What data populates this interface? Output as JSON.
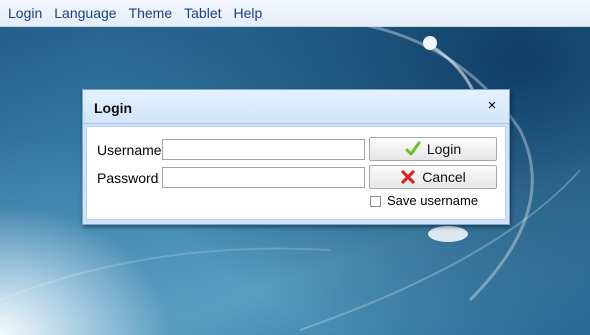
{
  "menubar": {
    "items": [
      {
        "label": "Login"
      },
      {
        "label": "Language"
      },
      {
        "label": "Theme"
      },
      {
        "label": "Tablet"
      },
      {
        "label": "Help"
      }
    ]
  },
  "dialog": {
    "title": "Login",
    "close_glyph": "×",
    "username_label": "Username",
    "password_label": "Password",
    "username_value": "",
    "password_value": "",
    "login_button_label": "Login",
    "cancel_button_label": "Cancel",
    "save_username_label": "Save username",
    "save_username_checked": false
  },
  "icons": {
    "login_icon": "checkmark-icon",
    "cancel_icon": "red-x-icon"
  },
  "colors": {
    "menu_text": "#1b3f8a",
    "dialog_frame": "#cfe3fa",
    "checkmark": "#6bbf2a",
    "cancel_x": "#d8261f"
  }
}
